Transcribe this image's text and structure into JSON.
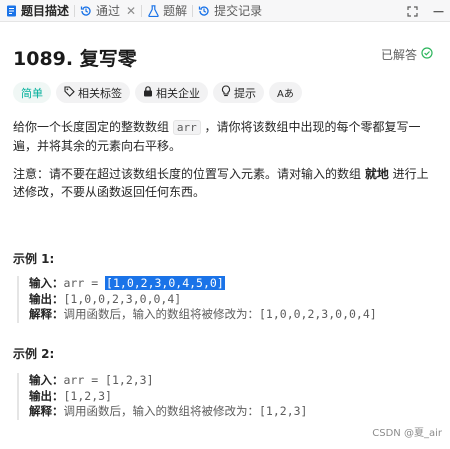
{
  "tabs": [
    {
      "label": "题目描述",
      "icon": "document-icon"
    },
    {
      "label": "通过",
      "icon": "history-icon"
    },
    {
      "label": "题解",
      "icon": "flask-icon"
    },
    {
      "label": "提交记录",
      "icon": "history-icon"
    }
  ],
  "problem": {
    "title": "1089. 复写零",
    "status": "已解答"
  },
  "tags": [
    {
      "label": "简单",
      "icon": ""
    },
    {
      "label": "相关标签",
      "icon": "tag-icon"
    },
    {
      "label": "相关企业",
      "icon": "lock-icon"
    },
    {
      "label": "提示",
      "icon": "lightbulb-icon"
    },
    {
      "label": "Aあ",
      "icon": "translate-icon"
    }
  ],
  "description": {
    "p1_a": "给你一个长度固定的整数数组 ",
    "p1_code": "arr",
    "p1_b": " ，请你将该数组中出现的每个零都复写一遍，并将其余的元素向右平移。",
    "p2_a": "注意：请不要在超过该数组长度的位置写入元素。请对输入的数组 ",
    "p2_bold": "就地",
    "p2_b": " 进行上述修改，不要从函数返回任何东西。"
  },
  "examples": [
    {
      "heading": "示例 1:",
      "input_label": "输入：",
      "input_prefix": "arr = ",
      "input_value": "[1,0,2,3,0,4,5,0]",
      "output_label": "输出：",
      "output_value": "[1,0,0,2,3,0,0,4]",
      "explain_label": "解释：",
      "explain_value": "调用函数后，输入的数组将被修改为：[1,0,0,2,3,0,0,4]"
    },
    {
      "heading": "示例 2:",
      "input_label": "输入：",
      "input_prefix": "arr = ",
      "input_value": "[1,2,3]",
      "output_label": "输出：",
      "output_value": "[1,2,3]",
      "explain_label": "解释：",
      "explain_value": "调用函数后，输入的数组将被修改为：[1,2,3]"
    }
  ],
  "watermark": "CSDN @夏_air",
  "colors": {
    "accent_easy": "#00af9b",
    "solved_check": "#2db55d",
    "highlight": "#1a73e8"
  }
}
